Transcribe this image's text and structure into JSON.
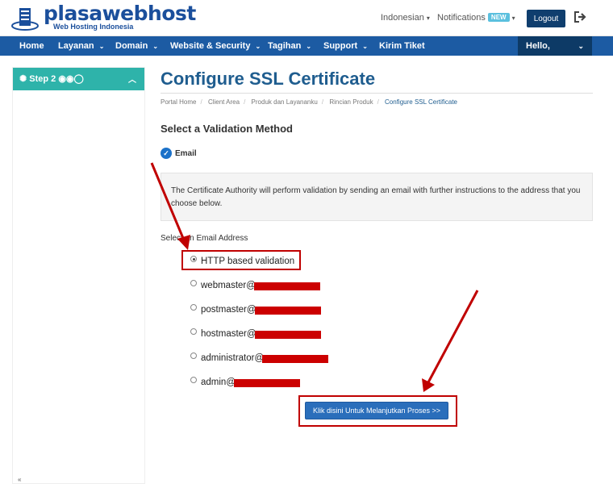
{
  "header": {
    "logo_text": "plasawebhost",
    "logo_sub": "Web Hosting Indonesia",
    "language": "Indonesian",
    "notifications": "Notifications",
    "new_badge": "NEW",
    "logout": "Logout"
  },
  "nav": {
    "items": [
      "Home",
      "Layanan",
      "Domain",
      "Website & Security",
      "Tagihan",
      "Support",
      "Kirim Tiket"
    ],
    "hello": "Hello,"
  },
  "sidebar": {
    "step": "Step 2"
  },
  "page": {
    "title": "Configure SSL Certificate",
    "breadcrumb": [
      "Portal Home",
      "Client Area",
      "Produk dan Layananku",
      "Rincian Produk",
      "Configure SSL Certificate"
    ],
    "section_title": "Select a Validation Method",
    "method": "Email",
    "info": "The Certificate Authority will perform validation by sending an email with further instructions to the address that you choose below.",
    "select_label": "Select an Email Address",
    "options": [
      {
        "label": "HTTP based validation",
        "checked": true
      },
      {
        "label": "webmaster@",
        "checked": false
      },
      {
        "label": "postmaster@",
        "checked": false
      },
      {
        "label": "hostmaster@",
        "checked": false
      },
      {
        "label": "administrator@",
        "checked": false
      },
      {
        "label": "admin@",
        "checked": false
      }
    ],
    "continue_button": "Klik disini Untuk Melanjutkan Proses >>"
  },
  "colors": {
    "nav": "#1c5ba3",
    "title": "#1f5d8f",
    "sidebar_head": "#2eb3aa",
    "annotation": "#c00000",
    "button": "#2a6ebb"
  }
}
